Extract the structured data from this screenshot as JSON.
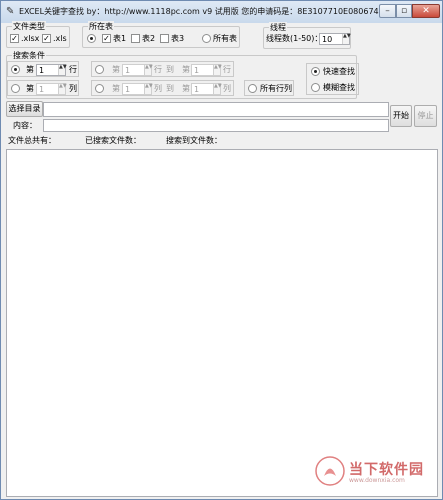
{
  "window": {
    "title": "EXCEL关键字查找  by：http://www.1118pc.com  v9 试用版  您的申请码是：8E3107710E0806742026",
    "min_icon": "minimize-icon",
    "max_icon": "maximize-icon",
    "close_icon": "close-icon",
    "min_glyph": "–",
    "max_glyph": "▫",
    "close_glyph": "✕"
  },
  "file_type": {
    "label": "文件类型",
    "options": [
      {
        "label": ".xlsx",
        "checked": true,
        "mark": "✓"
      },
      {
        "label": ".xls",
        "checked": true,
        "mark": "✓"
      }
    ]
  },
  "sheet": {
    "label": "所在表",
    "options": [
      {
        "label": "表1",
        "checked": true,
        "mark": "✓"
      },
      {
        "label": "表2",
        "checked": false,
        "mark": ""
      },
      {
        "label": "表3",
        "checked": false,
        "mark": ""
      }
    ],
    "all_label": "所有表"
  },
  "threads": {
    "label": "线程",
    "caption": "线程数(1-50)：",
    "value": "10"
  },
  "search": {
    "label": "搜索条件",
    "di": "第",
    "to": "到",
    "row": "行",
    "col": "列",
    "row_value": "1",
    "col_value": "1",
    "range_value": "1",
    "all_rows_cols": "所有行列",
    "fast": "快速查找",
    "fuzzy": "模糊查找"
  },
  "actions": {
    "choose_dir": "选择目录",
    "content_label": "内容：",
    "start": "开始",
    "stop": "停止",
    "spin_arrows": "▲▼"
  },
  "status": {
    "total": "文件总共有：",
    "searched": "已搜索文件数：",
    "found": "搜索到文件数："
  },
  "watermark": {
    "text": "当下软件园",
    "sub": "www.downxia.com"
  }
}
